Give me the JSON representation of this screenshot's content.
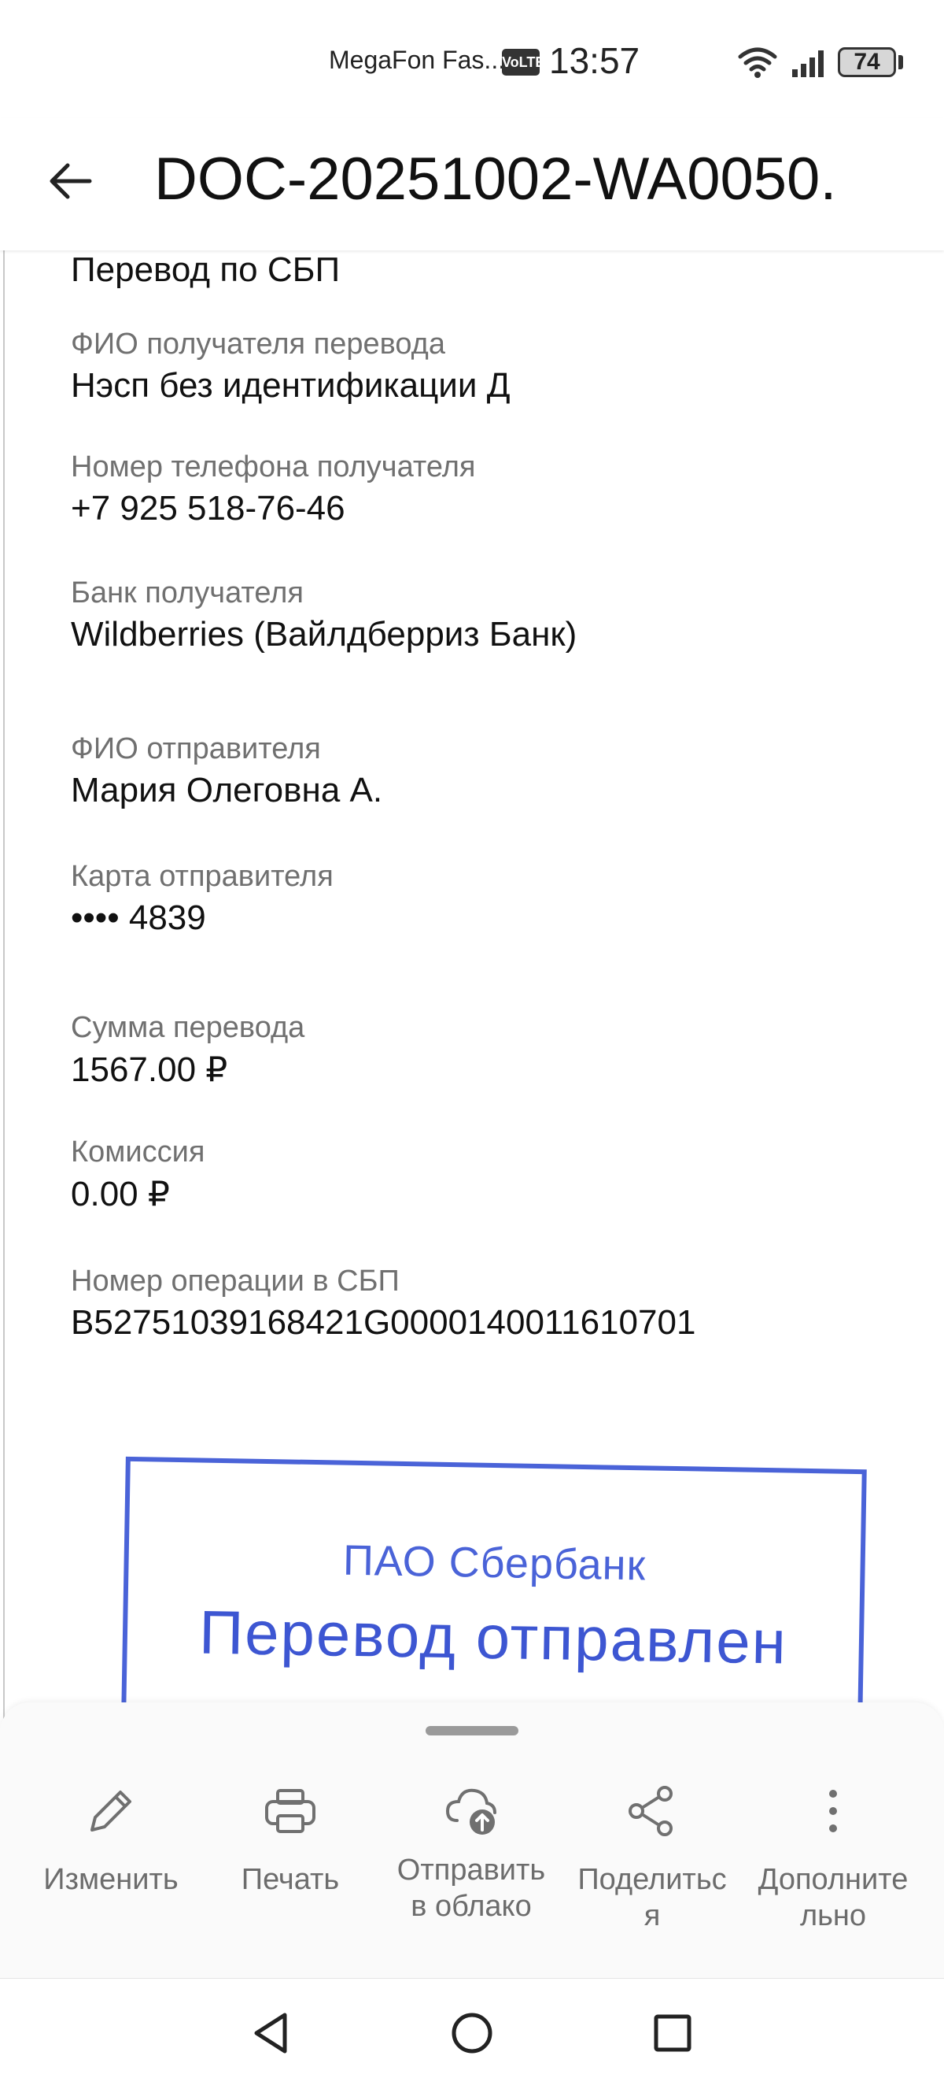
{
  "status_bar": {
    "carrier": "MegaFon Fas...",
    "volte": "VoLTE",
    "time": "13:57",
    "battery": "74",
    "icons": [
      "wifi-icon",
      "signal-icon",
      "battery-icon"
    ]
  },
  "app_bar": {
    "back_icon": "arrow-left-icon",
    "title": "DOC-20251002-WA0050."
  },
  "document": {
    "transfer_type": "Перевод по СБП",
    "fields": [
      {
        "label": "ФИО получателя перевода",
        "value": "Нэсп без идентификации Д"
      },
      {
        "label": "Номер телефона получателя",
        "value": "+7 925 518-76-46"
      },
      {
        "label": "Банк получателя",
        "value": "Wildberries (Вайлдберриз Банк)"
      },
      {
        "label": "ФИО отправителя",
        "value": "Мария Олеговна А."
      },
      {
        "label": "Карта отправителя",
        "value": "•••• 4839"
      },
      {
        "label": "Сумма перевода",
        "value": "1567.00  ₽"
      },
      {
        "label": "Комиссия",
        "value": "0.00  ₽"
      },
      {
        "label": "Номер операции в СБП",
        "value": "B52751039168421G0000140011610701"
      }
    ],
    "stamp": {
      "bank": "ПАО Сбербанк",
      "status": "Перевод отправлен",
      "color": "#4a63d8"
    }
  },
  "bottom_sheet": {
    "actions": [
      {
        "icon": "pencil-icon",
        "label_lines": [
          "Изменить"
        ]
      },
      {
        "icon": "printer-icon",
        "label_lines": [
          "Печать"
        ]
      },
      {
        "icon": "cloud-upload-icon",
        "label_lines": [
          "Отправить",
          "в облако"
        ]
      },
      {
        "icon": "share-icon",
        "label_lines": [
          "Поделитьс",
          "я"
        ]
      },
      {
        "icon": "more-vertical-icon",
        "label_lines": [
          "Дополните",
          "льно"
        ]
      }
    ]
  },
  "nav_bar": {
    "buttons": [
      "back-triangle-icon",
      "home-circle-icon",
      "recents-square-icon"
    ]
  }
}
